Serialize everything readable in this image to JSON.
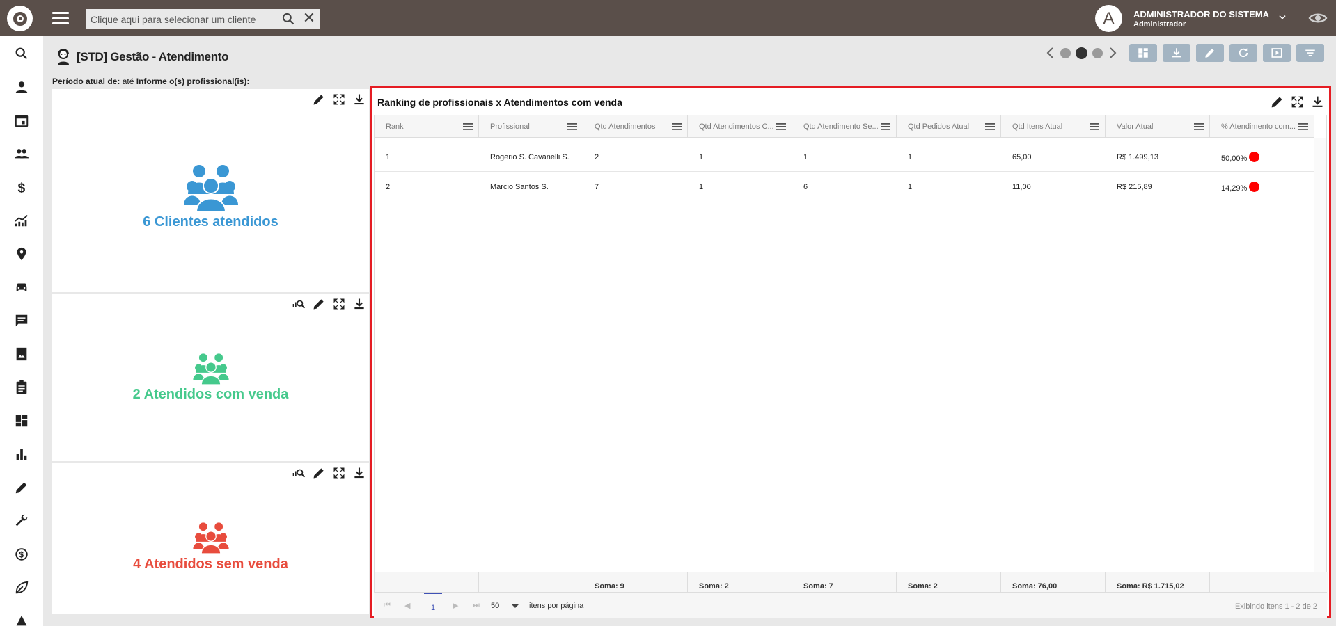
{
  "topbar": {
    "search_placeholder": "Clique aqui para selecionar um cliente",
    "avatar_letter": "A",
    "user_name": "ADMINISTRADOR DO SISTEMA",
    "user_role": "Administrador"
  },
  "sidebar": {
    "items": [
      "search-icon",
      "user-icon",
      "calendar-icon",
      "group-icon",
      "dollar-icon",
      "trend-icon",
      "location-icon",
      "car-icon",
      "chat-icon",
      "photo-album-icon",
      "clipboard-icon",
      "dashboard-icon",
      "bar-chart-icon",
      "pencil-icon",
      "wrench-icon",
      "money-cycle-icon",
      "leaf-icon",
      "alert-icon"
    ]
  },
  "page": {
    "title": "[STD] Gestão - Atendimento",
    "period_label": "Período atual de:",
    "period_value": "até",
    "professional_label": "Informe o(s) profissional(is):"
  },
  "widgets": [
    {
      "kpi": "6 Clientes atendidos",
      "color": "#3a97d4"
    },
    {
      "kpi": "2 Atendidos com venda",
      "color": "#45c98c"
    },
    {
      "kpi": "4 Atendidos sem venda",
      "color": "#e84c3d"
    }
  ],
  "table": {
    "title": "Ranking de profissionais x Atendimentos com venda",
    "columns": [
      "Rank",
      "Profissional",
      "Qtd Atendimentos",
      "Qtd Atendimentos C...",
      "Qtd Atendimento Se...",
      "Qtd Pedidos Atual",
      "Qtd Itens Atual",
      "Valor Atual",
      "% Atendimento com..."
    ],
    "rows": [
      [
        "1",
        "Rogerio S. Cavanelli S.",
        "2",
        "1",
        "1",
        "1",
        "65,00",
        "R$ 1.499,13",
        "50,00%"
      ],
      [
        "2",
        "Marcio Santos S.",
        "7",
        "1",
        "6",
        "1",
        "11,00",
        "R$ 215,89",
        "14,29%"
      ]
    ],
    "totals": [
      "",
      "",
      "Soma: 9",
      "Soma: 2",
      "Soma: 7",
      "Soma: 2",
      "Soma: 76,00",
      "Soma: R$ 1.715,02",
      ""
    ],
    "pager": {
      "current_page": "1",
      "page_size": "50",
      "per_page_label": "itens por página",
      "info": "Exibindo itens 1 - 2 de 2"
    }
  },
  "colors": {
    "topbar": "#5a4f4a",
    "tool_button": "#a3b4c2",
    "highlight_border": "#e51c23",
    "status_red": "#ff0000"
  }
}
